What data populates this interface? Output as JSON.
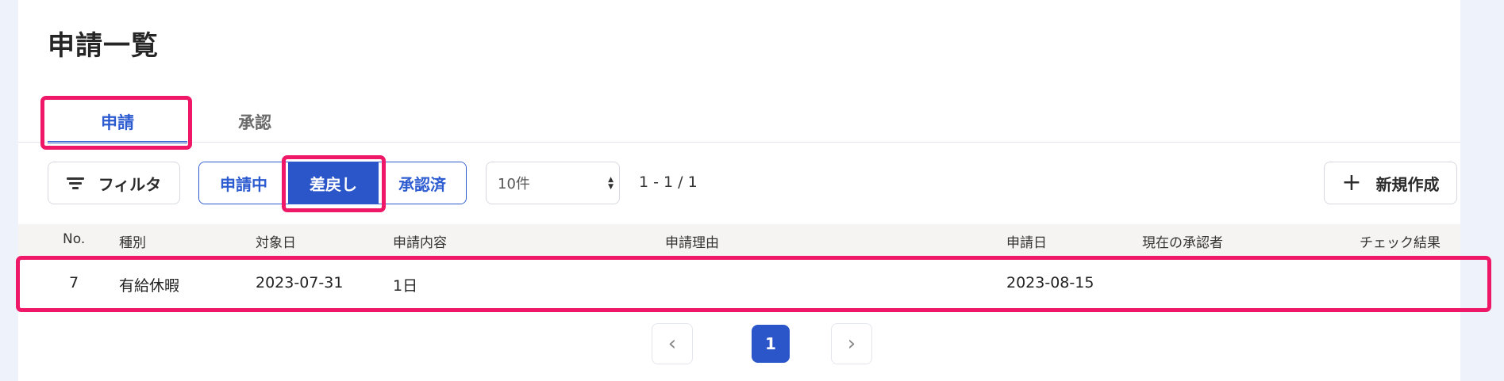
{
  "page": {
    "title": "申請一覧"
  },
  "tabs": [
    {
      "label": "申請",
      "active": true
    },
    {
      "label": "承認",
      "active": false
    }
  ],
  "toolbar": {
    "filter_label": "フィルタ",
    "status_filters": [
      {
        "label": "申請中",
        "selected": false
      },
      {
        "label": "差戻し",
        "selected": true
      },
      {
        "label": "承認済",
        "selected": false
      }
    ],
    "page_size_selected": "10件",
    "result_range": "1 - 1 / 1",
    "new_button_label": "新規作成"
  },
  "table": {
    "columns": [
      "No.",
      "種別",
      "対象日",
      "申請内容",
      "申請理由",
      "申請日",
      "現在の承認者",
      "チェック結果"
    ],
    "rows": [
      {
        "no": "7",
        "type": "有給休暇",
        "target_date": "2023-07-31",
        "content": "1日",
        "reason": "",
        "applied_date": "2023-08-15",
        "current_approver": "",
        "check_result": ""
      }
    ]
  },
  "pagination": {
    "current_page": "1"
  },
  "colors": {
    "accent": "#2b56c9",
    "highlight": "#ef1767"
  }
}
